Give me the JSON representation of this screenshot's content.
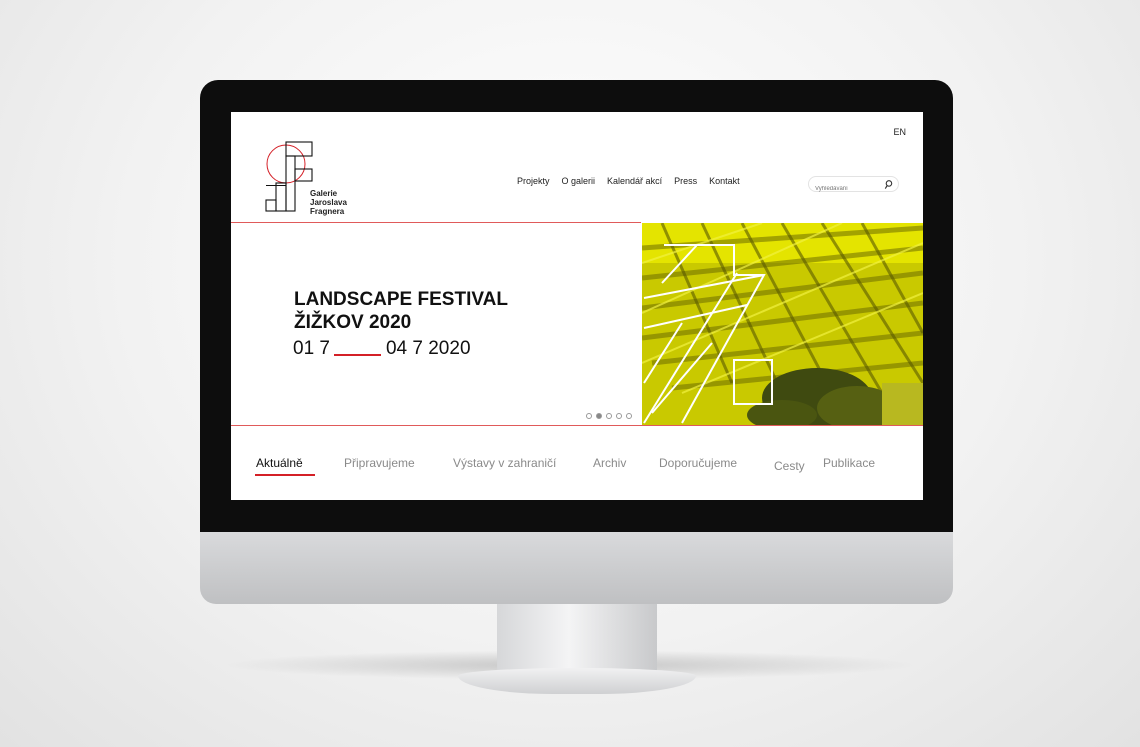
{
  "site": {
    "logo": {
      "line1": "Galerie",
      "line2": "Jaroslava",
      "line3": "Fragnera"
    },
    "language_switch": "EN",
    "nav": [
      {
        "label": "Projekty"
      },
      {
        "label": "O galerii"
      },
      {
        "label": "Kalendář akcí"
      },
      {
        "label": "Press"
      },
      {
        "label": "Kontakt"
      }
    ],
    "search": {
      "placeholder": "Vyhledávání"
    }
  },
  "hero": {
    "title_line1": "LANDSCAPE FESTIVAL",
    "title_line2": "ŽIŽKOV 2020",
    "date_start": "01 7",
    "date_end": "04 7 2020",
    "slider": {
      "slide_count": 5,
      "active_index": 1
    }
  },
  "tabs": [
    {
      "label": "Aktuálně",
      "active": true
    },
    {
      "label": "Připravujeme",
      "active": false
    },
    {
      "label": "Výstavy v zahraničí",
      "active": false
    },
    {
      "label": "Archiv",
      "active": false
    },
    {
      "label": "Doporučujeme",
      "active": false
    },
    {
      "label": "Cesty",
      "active": false
    },
    {
      "label": "Publikace",
      "active": false
    }
  ],
  "colors": {
    "accent": "#d42027",
    "hero_image_tint": "#d7d600",
    "text": "#111111",
    "muted": "#8a8a8a",
    "bezel": "#0d0d0d"
  },
  "icons": {
    "search": "search-icon",
    "logo": "gallery-logo-icon"
  }
}
